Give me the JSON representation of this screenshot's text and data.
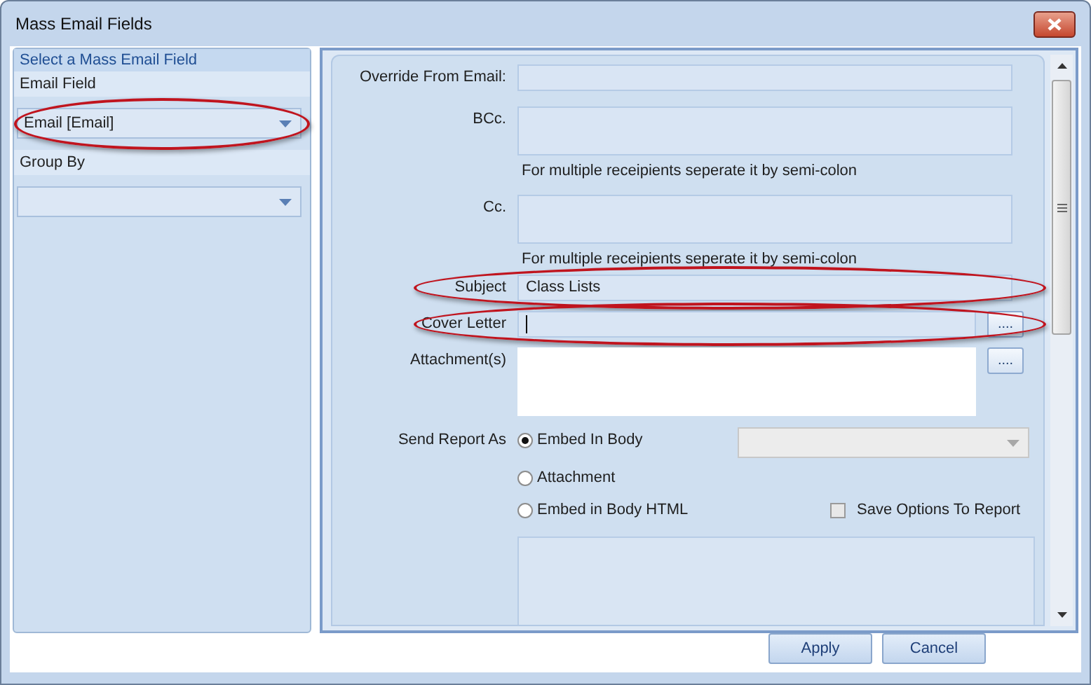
{
  "window": {
    "title": "Mass Email Fields"
  },
  "left_panel": {
    "header": "Select a Mass Email Field",
    "fields": [
      {
        "label": "Email Field",
        "value": "Email [Email]",
        "highlighted": true
      },
      {
        "label": "Group By",
        "highlighted": false
      }
    ]
  },
  "form": {
    "rows": [
      {
        "kind": "single",
        "label": "Override From Email:",
        "highlighted": false
      },
      {
        "kind": "multi",
        "label": "BCc.",
        "hint": "For multiple receipients seperate it by semi-colon",
        "highlighted": false
      },
      {
        "kind": "multi",
        "label": "Cc.",
        "hint": "For multiple receipients seperate it by semi-colon",
        "highlighted": false
      },
      {
        "kind": "single",
        "label": "Subject",
        "value": "Class Lists",
        "highlighted": true
      },
      {
        "kind": "browse",
        "label": "Cover Letter",
        "browse_button": "....",
        "focused": true,
        "highlighted": true
      },
      {
        "kind": "list",
        "label": "Attachment(s)",
        "browse_button": "....",
        "highlighted": false
      }
    ],
    "send_report": {
      "label": "Send Report As",
      "options": [
        {
          "label": "Embed In Body",
          "selected": true
        },
        {
          "label": "Attachment",
          "selected": false
        },
        {
          "label": "Embed in Body HTML",
          "selected": false
        }
      ],
      "save_options": {
        "label": "Save Options To Report",
        "checked": false
      }
    }
  },
  "buttons": [
    "Apply",
    "Cancel"
  ]
}
